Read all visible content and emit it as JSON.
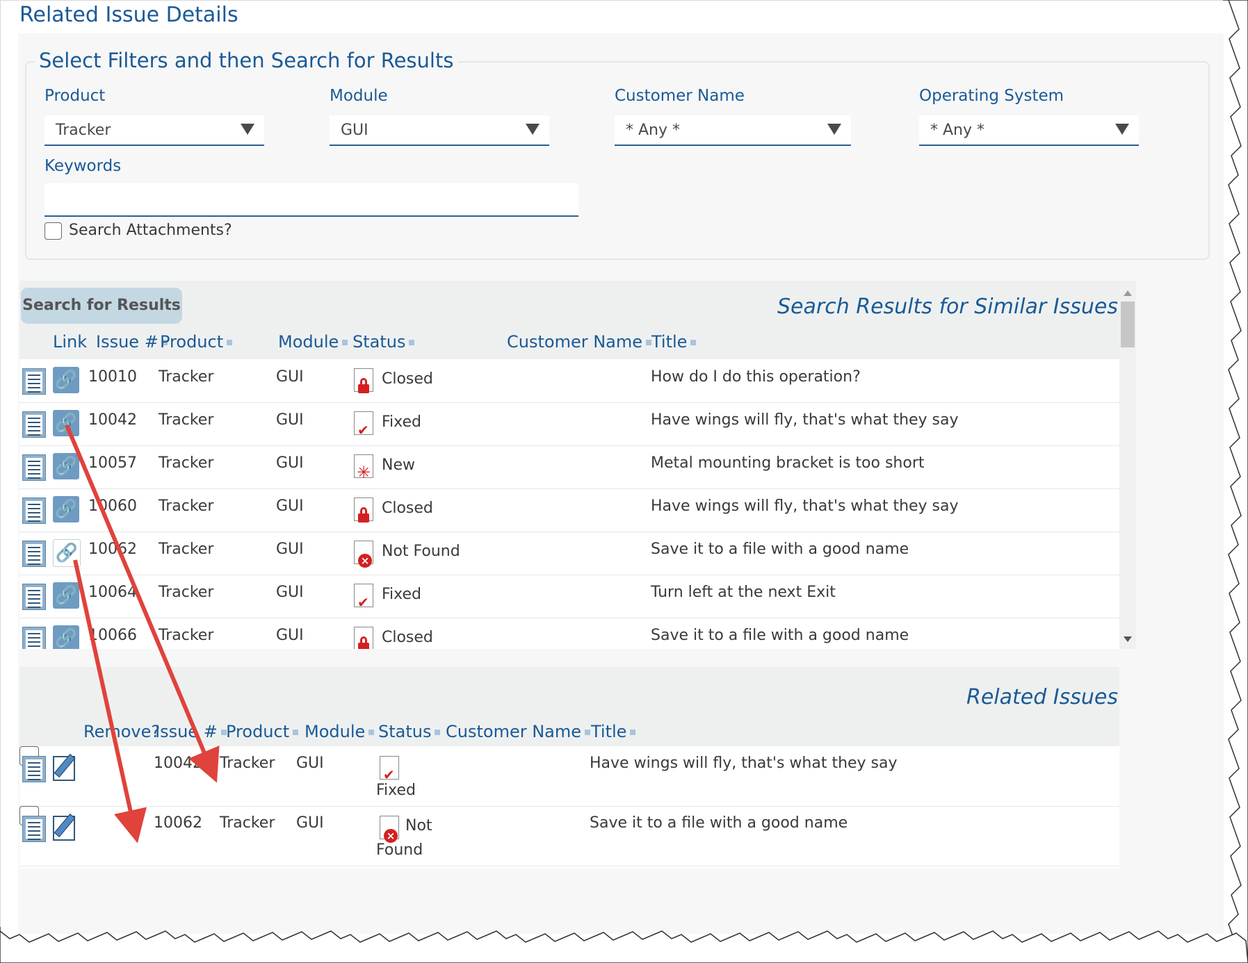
{
  "page_title": "Related Issue Details",
  "filters": {
    "legend": "Select Filters and then Search for Results",
    "product": {
      "label": "Product",
      "value": "Tracker"
    },
    "module": {
      "label": "Module",
      "value": "GUI"
    },
    "customer_name": {
      "label": "Customer Name",
      "value": "* Any *"
    },
    "operating_system": {
      "label": "Operating System",
      "value": "* Any *"
    },
    "keywords": {
      "label": "Keywords",
      "value": ""
    },
    "search_attachments": {
      "label": "Search Attachments?",
      "checked": false
    }
  },
  "search_results": {
    "button_label": "Search for Results",
    "heading": "Search Results for Similar Issues",
    "columns": [
      "Link",
      "Issue #",
      "Product",
      "Module",
      "Status",
      "Customer Name",
      "Title"
    ],
    "rows": [
      {
        "issue": "10010",
        "product": "Tracker",
        "module": "GUI",
        "status": "Closed",
        "status_icon": "lock-icon",
        "customer": "",
        "title": "How do I do this operation?"
      },
      {
        "issue": "10042",
        "product": "Tracker",
        "module": "GUI",
        "status": "Fixed",
        "status_icon": "check-icon",
        "customer": "",
        "title": "Have wings will fly, that's what they say"
      },
      {
        "issue": "10057",
        "product": "Tracker",
        "module": "GUI",
        "status": "New",
        "status_icon": "star-icon",
        "customer": "",
        "title": "Metal mounting bracket is too short"
      },
      {
        "issue": "10060",
        "product": "Tracker",
        "module": "GUI",
        "status": "Closed",
        "status_icon": "lock-icon",
        "customer": "",
        "title": "Have wings will fly, that's what they say"
      },
      {
        "issue": "10062",
        "product": "Tracker",
        "module": "GUI",
        "status": "Not Found",
        "status_icon": "x-circle-icon",
        "customer": "",
        "title": "Save it to a file with a good name",
        "link_selected": true
      },
      {
        "issue": "10064",
        "product": "Tracker",
        "module": "GUI",
        "status": "Fixed",
        "status_icon": "check-icon",
        "customer": "",
        "title": "Turn left at the next Exit"
      },
      {
        "issue": "10066",
        "product": "Tracker",
        "module": "GUI",
        "status": "Closed",
        "status_icon": "lock-icon",
        "customer": "",
        "title": "Save it to a file with a good name"
      }
    ]
  },
  "related_issues": {
    "heading": "Related Issues",
    "columns": [
      "Remove?",
      "Issue #",
      "Product",
      "Module",
      "Status",
      "Customer Name",
      "Title"
    ],
    "rows": [
      {
        "issue": "10042",
        "product": "Tracker",
        "module": "GUI",
        "status_line1": "",
        "status_line2": "Fixed",
        "status_icon": "check-icon",
        "title": "Have wings will fly, that's what they say"
      },
      {
        "issue": "10062",
        "product": "Tracker",
        "module": "GUI",
        "status_line1": "Not",
        "status_line2": "Found",
        "status_icon": "x-circle-icon",
        "title": "Save it to a file with a good name"
      }
    ]
  },
  "colors": {
    "accent": "#1a5a96",
    "link_icon": "#6f9bc2",
    "arrow": "#e0423c",
    "status_red": "#d42020"
  }
}
